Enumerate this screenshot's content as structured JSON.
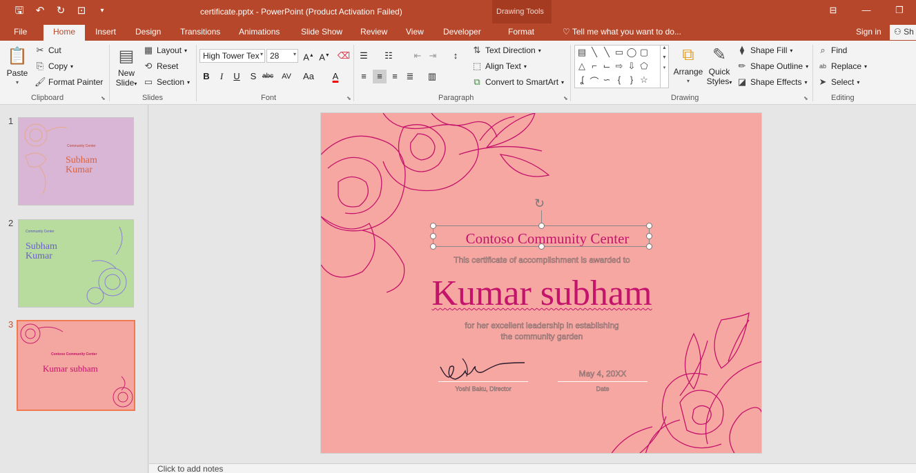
{
  "titlebar": {
    "title": "certificate.pptx - PowerPoint (Product Activation Failed)",
    "context_tab_group": "Drawing Tools"
  },
  "tabs": {
    "file": "File",
    "home": "Home",
    "insert": "Insert",
    "design": "Design",
    "transitions": "Transitions",
    "animations": "Animations",
    "slideshow": "Slide Show",
    "review": "Review",
    "view": "View",
    "developer": "Developer",
    "format": "Format",
    "tell_me": "Tell me what you want to do...",
    "sign_in": "Sign in",
    "share": "Sh"
  },
  "ribbon": {
    "clipboard": {
      "label": "Clipboard",
      "paste": "Paste",
      "cut": "Cut",
      "copy": "Copy",
      "format_painter": "Format Painter"
    },
    "slides": {
      "label": "Slides",
      "new_slide_1": "New",
      "new_slide_2": "Slide",
      "layout": "Layout",
      "reset": "Reset",
      "section": "Section"
    },
    "font": {
      "label": "Font",
      "font_name": "High Tower Tex",
      "font_size": "28",
      "bold": "B",
      "italic": "I",
      "underline": "U",
      "shadow": "S",
      "strike": "abc",
      "spacing": "AV",
      "case": "Aa",
      "color": "A"
    },
    "paragraph": {
      "label": "Paragraph",
      "text_direction": "Text Direction",
      "align_text": "Align Text",
      "convert_smartart": "Convert to SmartArt"
    },
    "drawing": {
      "label": "Drawing",
      "arrange": "Arrange",
      "quick_styles_1": "Quick",
      "quick_styles_2": "Styles",
      "shape_fill": "Shape Fill",
      "shape_outline": "Shape Outline",
      "shape_effects": "Shape Effects"
    },
    "editing": {
      "label": "Editing",
      "find": "Find",
      "replace": "Replace",
      "select": "Select"
    }
  },
  "thumbnails": [
    {
      "number": "1",
      "org": "Community Center",
      "name_line1": "Subham",
      "name_line2": "Kumar"
    },
    {
      "number": "2",
      "org": "Community Center",
      "name_line1": "Subham",
      "name_line2": "Kumar"
    },
    {
      "number": "3",
      "org": "Contoso Community Center",
      "name_line1": "Kumar subham",
      "name_line2": ""
    }
  ],
  "slide": {
    "organization": "Contoso Community Center",
    "awarded_line": "This certificate of accomplishment is awarded to",
    "recipient": "Kumar subham",
    "description_line1": "for her excellent leadership in establishing",
    "description_line2": "the community garden",
    "date": "May 4, 20XX",
    "signature_caption": "Yoshi Baku, Director",
    "date_caption": "Date"
  },
  "notes": {
    "placeholder": "Click to add notes"
  },
  "colors": {
    "accent": "#b7472a",
    "slide_background": "#f7a7a2",
    "title_text": "#c4136b",
    "selected_thumb_border": "#f0794f"
  }
}
